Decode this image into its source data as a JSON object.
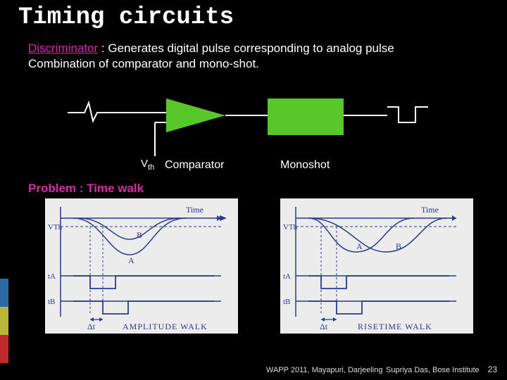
{
  "title": "Timing circuits",
  "discriminator_label": "Discriminator",
  "discriminator_text": " : Generates digital pulse corresponding to analog pulse",
  "body_line2": "Combination of comparator and mono-shot.",
  "vth_label": "V",
  "vth_sub": "th",
  "comparator_label": "Comparator",
  "monoshot_label": "Monoshot",
  "problem_label": "Problem : Time walk",
  "walk1": {
    "vth": "VTh",
    "time": "Time",
    "a": "A",
    "b": "B",
    "ta": "tA",
    "tb": "tB",
    "dt": "Δt",
    "caption": "AMPLITUDE WALK"
  },
  "walk2": {
    "vth": "VTh",
    "time": "Time",
    "a": "A",
    "b": "B",
    "ta": "tA",
    "tb": "tB",
    "dt": "Δt",
    "caption": "RISETIME WALK"
  },
  "footer": {
    "venue": "WAPP 2011, Mayapuri, Darjeeling",
    "author": "Supriya Das, Bose Institute",
    "page": "23"
  }
}
